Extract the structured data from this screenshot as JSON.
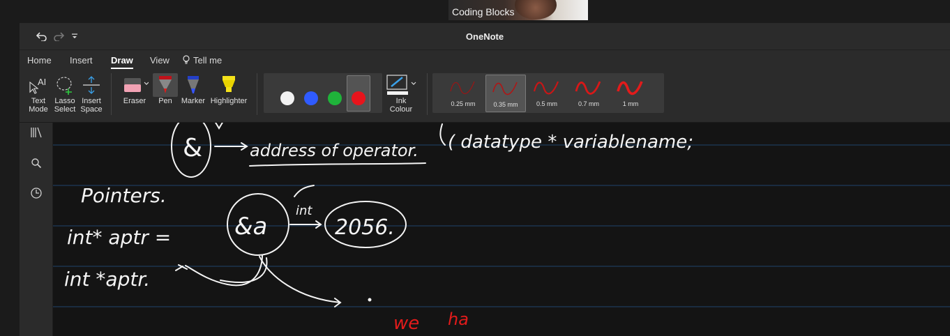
{
  "video": {
    "participant_name": "Coding Blocks"
  },
  "window": {
    "title": "OneNote"
  },
  "quick_access": {
    "undo_icon": "undo-icon",
    "redo_icon": "redo-icon",
    "customize_icon": "customize-icon"
  },
  "tabs": [
    {
      "label": "Home"
    },
    {
      "label": "Insert"
    },
    {
      "label": "Draw",
      "active": true
    },
    {
      "label": "View"
    },
    {
      "label": "Tell me"
    }
  ],
  "tools": {
    "text_mode": {
      "line1": "Text",
      "line2": "Mode"
    },
    "lasso_select": {
      "line1": "Lasso",
      "line2": "Select"
    },
    "insert_space": {
      "line1": "Insert",
      "line2": "Space"
    },
    "eraser": "Eraser",
    "pen": "Pen",
    "marker": "Marker",
    "highlighter": "Highlighter",
    "ink_colour": {
      "line1": "Ink",
      "line2": "Colour"
    }
  },
  "colors": {
    "white": "#f2f2f2",
    "blue": "#2f5bff",
    "green": "#1fb33a",
    "red": "#e8141c",
    "ink_white": "#f4f4f4",
    "ink_red": "#e21b1b",
    "rule_line": "#1e3a5a"
  },
  "thicknesses": [
    {
      "label": "0.25 mm"
    },
    {
      "label": "0.35 mm",
      "selected": true
    },
    {
      "label": "0.5 mm"
    },
    {
      "label": "0.7 mm"
    },
    {
      "label": "1 mm"
    }
  ],
  "rail_icons": [
    "notebooks-icon",
    "search-icon",
    "recent-icon"
  ],
  "notes": {
    "heading": "Pointers.",
    "ampersand_label": "address of operator.",
    "declaration": "( datatype * variablename;",
    "line1": "int* aptr =",
    "addr_expr": "&a",
    "int_label": "int",
    "value": "2056.",
    "line2": "int *aptr.",
    "red_text_1": "we",
    "red_text_2": "ha"
  }
}
